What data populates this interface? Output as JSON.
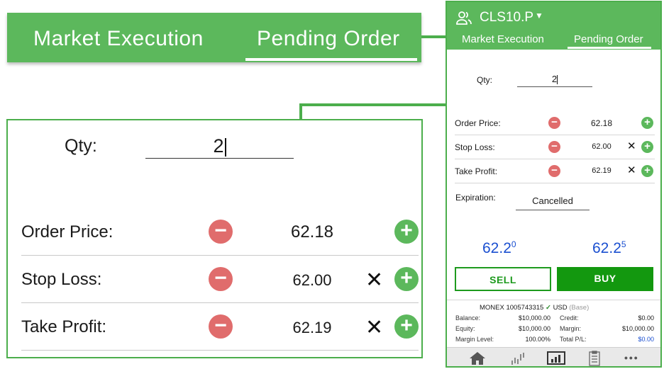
{
  "zoom_header": {
    "tab_market": "Market Execution",
    "tab_pending": "Pending Order"
  },
  "zoom_panel": {
    "qty_label": "Qty:",
    "qty_value": "2",
    "rows": [
      {
        "label": "Order Price:",
        "value": "62.18"
      },
      {
        "label": "Stop Loss:",
        "value": "62.00"
      },
      {
        "label": "Take Profit:",
        "value": "62.19"
      }
    ]
  },
  "phone": {
    "symbol": "CLS10.P",
    "tab_market": "Market Execution",
    "tab_pending": "Pending Order",
    "qty_label": "Qty:",
    "qty_value": "2",
    "rows": [
      {
        "label": "Order Price:",
        "value": "62.18"
      },
      {
        "label": "Stop Loss:",
        "value": "62.00"
      },
      {
        "label": "Take Profit:",
        "value": "62.19"
      }
    ],
    "expiration_label": "Expiration:",
    "expiration_value": "Cancelled",
    "sell_price_main": "62.2",
    "sell_price_sup": "0",
    "buy_price_main": "62.2",
    "buy_price_sup": "5",
    "sell_label": "SELL",
    "buy_label": "BUY",
    "account": {
      "name": "MONEX 1005743315",
      "currency": "USD",
      "currency_note": "(Base)",
      "balance_label": "Balance:",
      "balance": "$10,000.00",
      "credit_label": "Credit:",
      "credit": "$0.00",
      "equity_label": "Equity:",
      "equity": "$10,000.00",
      "margin_label": "Margin:",
      "margin": "$10,000.00",
      "margin_level_label": "Margin Level:",
      "margin_level": "100.00%",
      "total_pl_label": "Total P/L:",
      "total_pl": "$0.00"
    },
    "nav": [
      "home-icon",
      "chart-icon",
      "trade-icon",
      "orders-icon",
      "more-icon"
    ]
  },
  "colors": {
    "brand_green": "#5cb85c",
    "buy_green": "#13980f",
    "minus_red": "#e06c6c",
    "price_blue": "#1a4fd0"
  }
}
